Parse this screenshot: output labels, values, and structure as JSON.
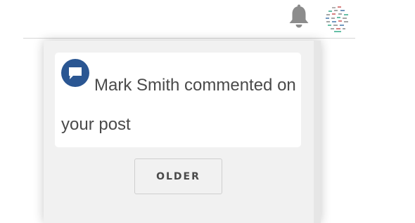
{
  "header": {
    "notifications_icon": "bell-icon",
    "profile_avatar": "avatar-image"
  },
  "notification": {
    "icon": "comment-bubble-icon",
    "text": "Mark Smith commented on your post"
  },
  "pagination": {
    "older_label": "OLDER"
  },
  "colors": {
    "icon_blue": "#2a5692",
    "bell_gray": "#8c8c8c",
    "panel_bg": "#f1f1f1",
    "text": "#4a4a4a"
  }
}
